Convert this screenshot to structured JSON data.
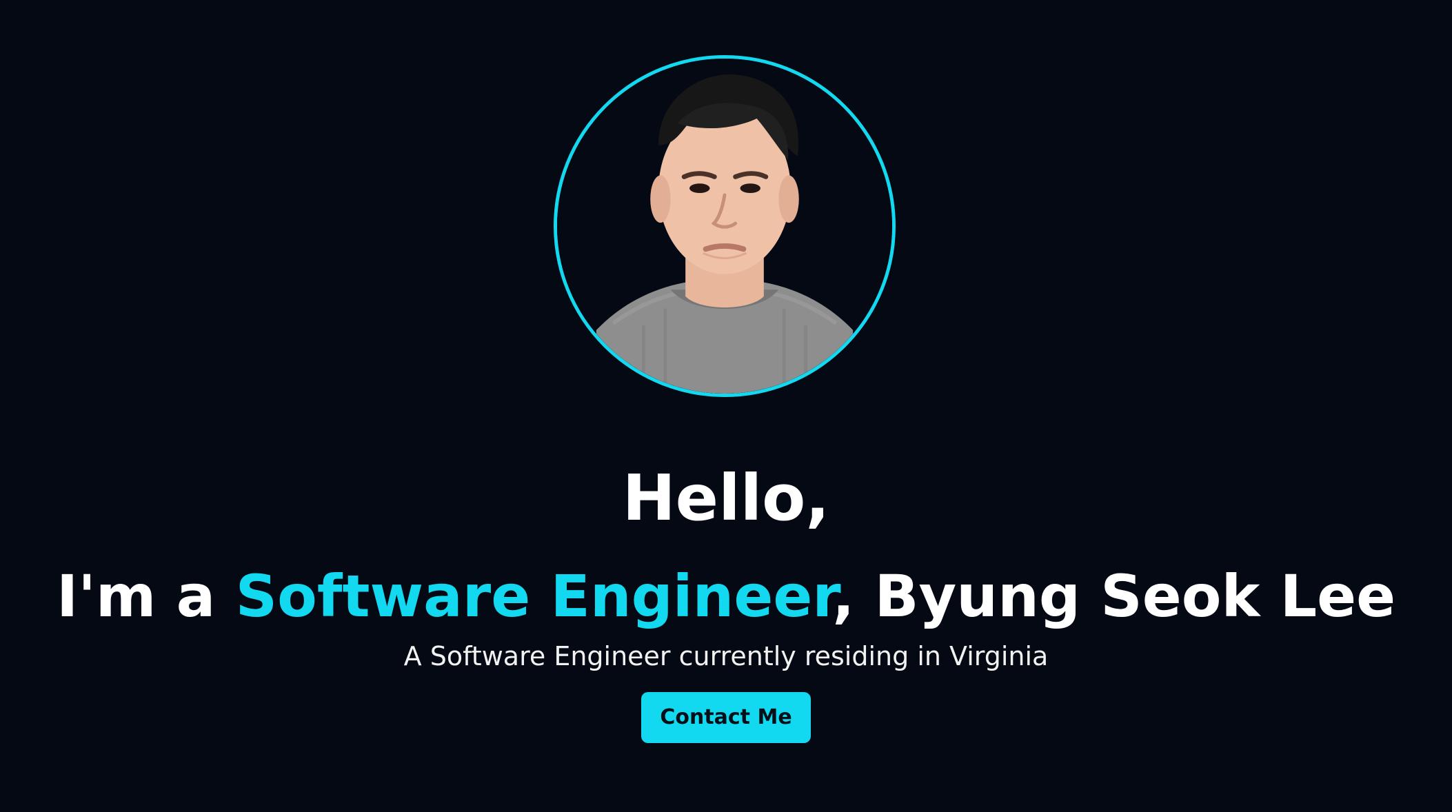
{
  "hero": {
    "greeting": "Hello,",
    "intro_prefix": "I'm a ",
    "role": "Software Engineer",
    "intro_suffix": ", Byung Seok Lee",
    "subtitle": "A Software Engineer currently residing in Virginia",
    "contact_button_label": "Contact Me"
  },
  "colors": {
    "background": "#050914",
    "accent": "#12d9ef",
    "text": "#ffffff"
  }
}
